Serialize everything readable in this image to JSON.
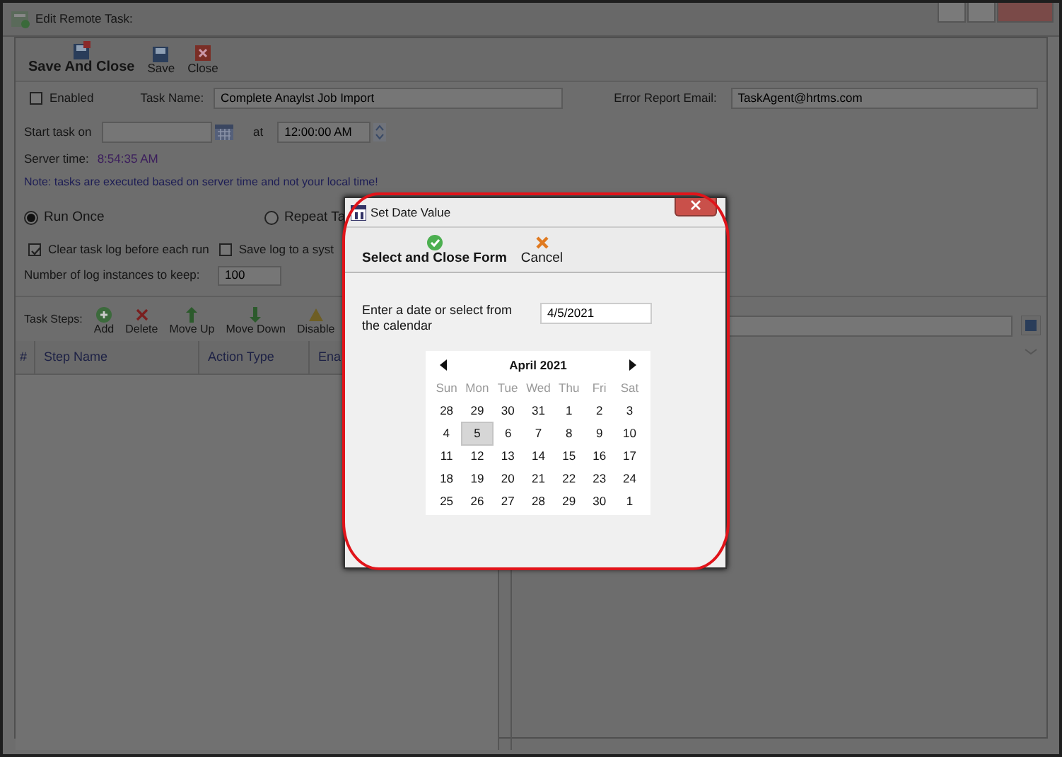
{
  "window": {
    "title": "Edit Remote Task:"
  },
  "toolbar": [
    {
      "label": "Save And Close",
      "kind": "save_close"
    },
    {
      "label": "Save",
      "kind": "save"
    },
    {
      "label": "Close",
      "kind": "close"
    }
  ],
  "form": {
    "enabled": {
      "label": "Enabled",
      "checked": false
    },
    "task_name": {
      "label": "Task Name:",
      "value": "Complete Anaylst Job Import"
    },
    "error_email": {
      "label": "Error Report Email:",
      "value": "TaskAgent@hrtms.com"
    },
    "start": {
      "label": "Start task on",
      "at_label": "at",
      "time": "12:00:00 AM"
    },
    "server_time": {
      "label": "Server time:",
      "value": "8:54:35 AM"
    },
    "note": "Note: tasks are executed based on server time and not your local time!",
    "schedule": [
      {
        "label": "Run Once",
        "selected": true
      },
      {
        "label": "Repeat Ta",
        "selected": false
      }
    ],
    "log_options": [
      {
        "label": "Clear task log before each run",
        "checked": true
      },
      {
        "label": "Save log to a syst",
        "checked": false
      }
    ],
    "log_instances": {
      "label": "Number of log instances to keep:",
      "value": "100"
    }
  },
  "task_steps": {
    "label": "Task Steps:",
    "actions": [
      {
        "label": "Add",
        "kind": "add"
      },
      {
        "label": "Delete",
        "kind": "delete"
      },
      {
        "label": "Move Up",
        "kind": "up"
      },
      {
        "label": "Move Down",
        "kind": "down"
      },
      {
        "label": "Disable",
        "kind": "disable"
      }
    ],
    "columns": [
      "#",
      "Step Name",
      "Action Type",
      "Ena"
    ]
  },
  "dialog": {
    "title": "Set Date Value",
    "toolbar": [
      {
        "label": "Select and Close Form",
        "kind": "select"
      },
      {
        "label": "Cancel",
        "kind": "cancel"
      }
    ],
    "prompt": "Enter a date or select from the calendar",
    "value": "4/5/2021",
    "calendar": {
      "month": "April 2021",
      "weekdays": [
        "Sun",
        "Mon",
        "Tue",
        "Wed",
        "Thu",
        "Fri",
        "Sat"
      ],
      "weeks": [
        [
          {
            "day": "28",
            "selected": false
          },
          {
            "day": "29",
            "selected": false
          },
          {
            "day": "30",
            "selected": false
          },
          {
            "day": "31",
            "selected": false
          },
          {
            "day": "1",
            "selected": false
          },
          {
            "day": "2",
            "selected": false
          },
          {
            "day": "3",
            "selected": false
          }
        ],
        [
          {
            "day": "4",
            "selected": false
          },
          {
            "day": "5",
            "selected": true
          },
          {
            "day": "6",
            "selected": false
          },
          {
            "day": "7",
            "selected": false
          },
          {
            "day": "8",
            "selected": false
          },
          {
            "day": "9",
            "selected": false
          },
          {
            "day": "10",
            "selected": false
          }
        ],
        [
          {
            "day": "11",
            "selected": false
          },
          {
            "day": "12",
            "selected": false
          },
          {
            "day": "13",
            "selected": false
          },
          {
            "day": "14",
            "selected": false
          },
          {
            "day": "15",
            "selected": false
          },
          {
            "day": "16",
            "selected": false
          },
          {
            "day": "17",
            "selected": false
          }
        ],
        [
          {
            "day": "18",
            "selected": false
          },
          {
            "day": "19",
            "selected": false
          },
          {
            "day": "20",
            "selected": false
          },
          {
            "day": "21",
            "selected": false
          },
          {
            "day": "22",
            "selected": false
          },
          {
            "day": "23",
            "selected": false
          },
          {
            "day": "24",
            "selected": false
          }
        ],
        [
          {
            "day": "25",
            "selected": false
          },
          {
            "day": "26",
            "selected": false
          },
          {
            "day": "27",
            "selected": false
          },
          {
            "day": "28",
            "selected": false
          },
          {
            "day": "29",
            "selected": false
          },
          {
            "day": "30",
            "selected": false
          },
          {
            "day": "1",
            "selected": false
          }
        ]
      ]
    }
  }
}
